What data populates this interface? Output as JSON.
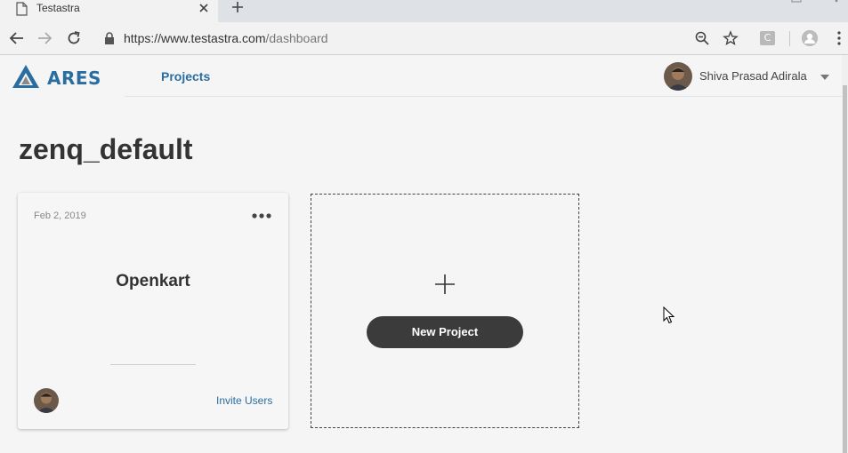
{
  "browser": {
    "tab_title": "Testastra",
    "url_host": "https://www.testastra.com",
    "url_path": "/dashboard",
    "extension_label": "C"
  },
  "header": {
    "brand": "ARES",
    "nav_projects": "Projects",
    "user_name": "Shiva Prasad Adirala"
  },
  "page": {
    "title": "zenq_default"
  },
  "project_card": {
    "date": "Feb 2, 2019",
    "name": "Openkart",
    "invite_label": "Invite Users"
  },
  "new_project": {
    "button_label": "New Project"
  },
  "colors": {
    "brand_blue": "#2a6da0",
    "button_dark": "#3b3b3b"
  }
}
